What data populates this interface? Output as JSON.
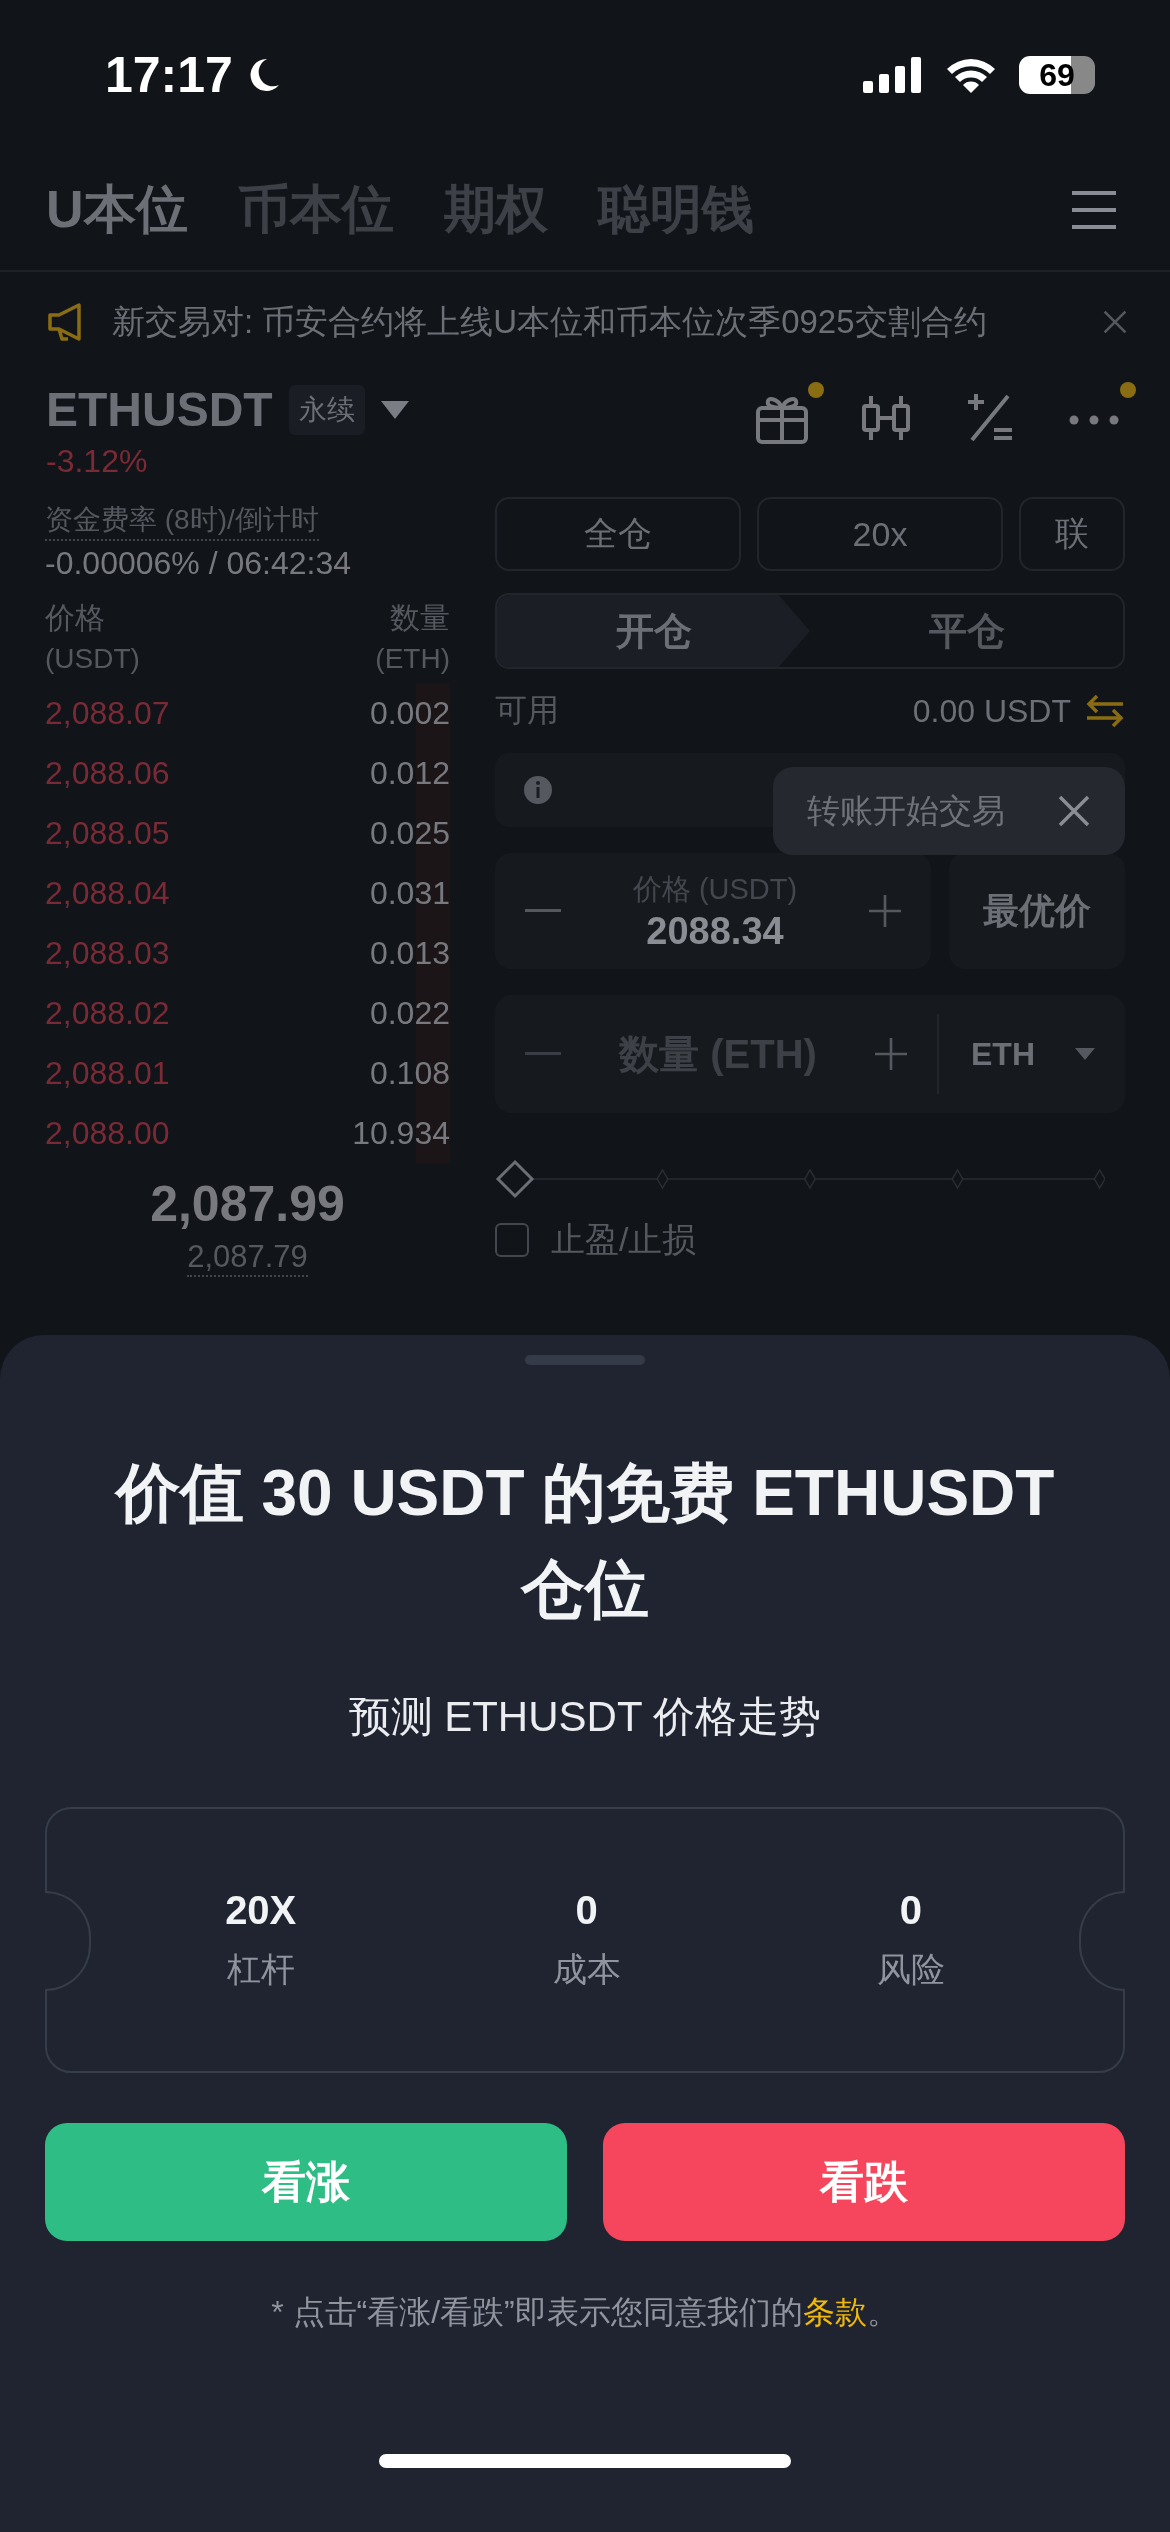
{
  "status_bar": {
    "time": "17:17",
    "battery": "69"
  },
  "nav_tabs": [
    {
      "label": "U本位",
      "selected": true
    },
    {
      "label": "币本位",
      "selected": false
    },
    {
      "label": "期权",
      "selected": false
    },
    {
      "label": "聪明钱",
      "selected": false
    }
  ],
  "announcement": {
    "text": "新交易对: 币安合约将上线U本位和币本位次季0925交割合约"
  },
  "symbol": {
    "name": "ETHUSDT",
    "badge": "永续",
    "change": "-3.12%"
  },
  "toolbar": [
    {
      "kind": "gift",
      "dot": true
    },
    {
      "kind": "candles",
      "dot": false
    },
    {
      "kind": "calc",
      "dot": false
    },
    {
      "kind": "more",
      "dot": true
    }
  ],
  "funding": {
    "label": "资金费率 (8时)/倒计时",
    "value": "-0.00006% / 06:42:34"
  },
  "order_book": {
    "columns": [
      {
        "label": "价格",
        "unit": "(USDT)"
      },
      {
        "label": "数量",
        "unit": "(ETH)"
      }
    ],
    "asks": [
      {
        "price": "2,088.07",
        "qty": "0.002"
      },
      {
        "price": "2,088.06",
        "qty": "0.012"
      },
      {
        "price": "2,088.05",
        "qty": "0.025"
      },
      {
        "price": "2,088.04",
        "qty": "0.031"
      },
      {
        "price": "2,088.03",
        "qty": "0.013"
      },
      {
        "price": "2,088.02",
        "qty": "0.022"
      },
      {
        "price": "2,088.01",
        "qty": "0.108"
      },
      {
        "price": "2,088.00",
        "qty": "10.934"
      }
    ],
    "last_price": "2,087.99",
    "mark_price": "2,087.79"
  },
  "order_form": {
    "margin_buttons": [
      "全仓",
      "20x",
      "联"
    ],
    "sides": [
      {
        "label": "开仓",
        "selected": true
      },
      {
        "label": "平仓",
        "selected": false
      }
    ],
    "available": {
      "label": "可用",
      "value": "0.00 USDT"
    },
    "price_field": {
      "label": "价格 (USDT)",
      "value": "2088.34"
    },
    "best_price": "最优价",
    "quantity_field": {
      "placeholder": "数量 (ETH)",
      "unit": "ETH"
    },
    "slider": {
      "level": 0
    },
    "tp_sl": {
      "label": "止盈/止损",
      "checked": false
    }
  },
  "tooltip": {
    "text": "转账开始交易"
  },
  "sheet": {
    "title": "价值 30 USDT 的免费 ETHUSDT 仓位",
    "subtitle": "预测 ETHUSDT 价格走势",
    "stats": [
      {
        "value": "20X",
        "label": "杠杆"
      },
      {
        "value": "0",
        "label": "成本"
      },
      {
        "value": "0",
        "label": "风险"
      }
    ],
    "buttons": [
      {
        "label": "看涨",
        "kind": "up"
      },
      {
        "label": "看跌",
        "kind": "down"
      }
    ],
    "disclaimer": {
      "before": "* 点击“看涨/看跌”即表示您同意我们的",
      "link": "条款",
      "after": "。"
    }
  }
}
